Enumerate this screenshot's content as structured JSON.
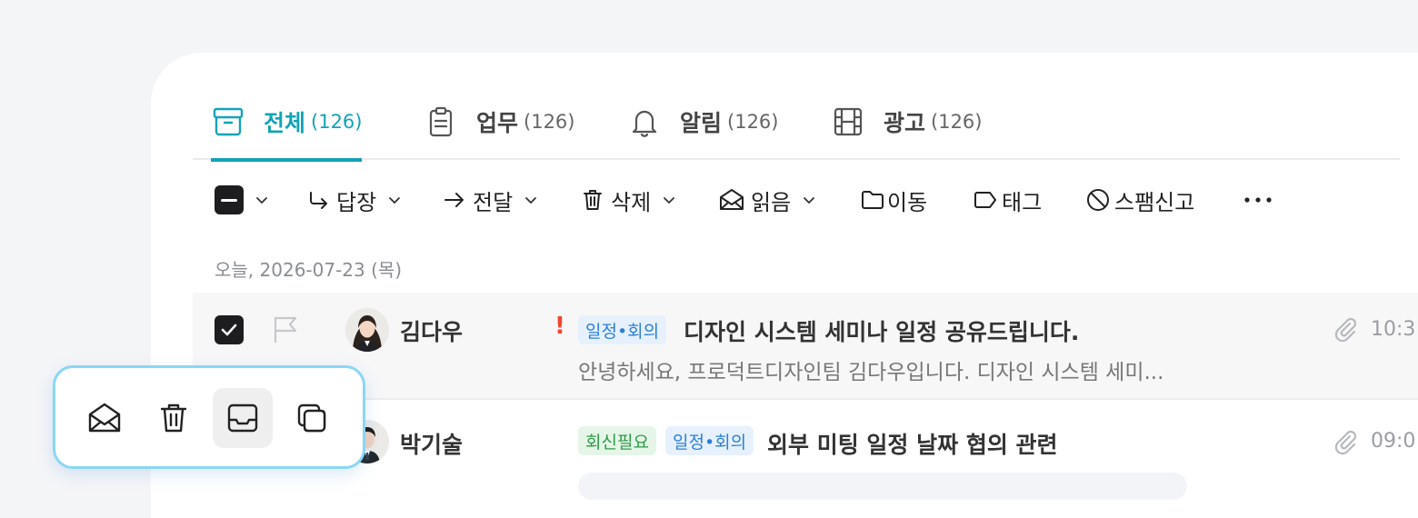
{
  "tabs": [
    {
      "label": "전체",
      "count": "(126)",
      "icon": "archive-box-icon",
      "active": true
    },
    {
      "label": "업무",
      "count": "(126)",
      "icon": "clipboard-icon",
      "active": false
    },
    {
      "label": "알림",
      "count": "(126)",
      "icon": "bell-icon",
      "active": false
    },
    {
      "label": "광고",
      "count": "(126)",
      "icon": "film-icon",
      "active": false
    }
  ],
  "toolbar": {
    "reply": "답장",
    "forward": "전달",
    "delete": "삭제",
    "read": "읽음",
    "move": "이동",
    "tag": "태그",
    "spam": "스팸신고"
  },
  "date_header": "오늘, 2026-07-23 (목)",
  "messages": [
    {
      "sender": "김다우",
      "important": "!",
      "tags": [
        "일정•회의"
      ],
      "subject": "디자인 시스템 세미나 일정 공유드립니다.",
      "preview": "안녕하세요, 프로덕트디자인팀 김다우입니다. 디자인 시스템 세미...",
      "time": "10:3",
      "selected": true
    },
    {
      "sender": "박기술",
      "tags": [
        "회신필요",
        "일정•회의"
      ],
      "subject": "외부 미팅 일정 날짜 협의 관련",
      "time": "09:0",
      "selected": false
    }
  ],
  "colors": {
    "accent": "#13a3b7",
    "important": "#f0462f",
    "tag_blue_bg": "#e6f1fd",
    "tag_blue_text": "#2d7fd8",
    "tag_green_bg": "#e5f6e8",
    "tag_green_text": "#2f9b4a",
    "quick_actions_border": "#8ad6f5"
  },
  "quick_actions": [
    {
      "icon": "envelope-open-icon"
    },
    {
      "icon": "trash-icon"
    },
    {
      "icon": "inbox-tray-icon"
    },
    {
      "icon": "copy-icon"
    }
  ]
}
